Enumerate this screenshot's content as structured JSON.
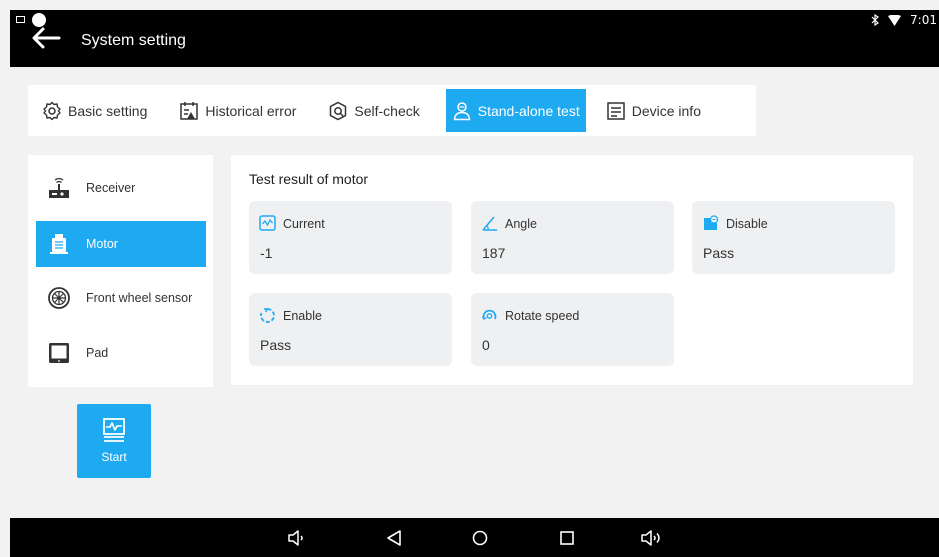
{
  "app": {
    "title": "System setting"
  },
  "status": {
    "time": "7:01",
    "bluetooth": "bluetooth-icon",
    "wifi": "wifi-icon"
  },
  "tabs": [
    {
      "label": "Basic setting",
      "icon": "gear-icon",
      "active": false
    },
    {
      "label": "Historical error",
      "icon": "error-log-icon",
      "active": false
    },
    {
      "label": "Self-check",
      "icon": "self-check-icon",
      "active": false
    },
    {
      "label": "Stand-alone test",
      "icon": "person-test-icon",
      "active": true
    },
    {
      "label": "Device info",
      "icon": "device-info-icon",
      "active": false
    }
  ],
  "sidebar": {
    "items": [
      {
        "label": "Receiver",
        "icon": "receiver-icon",
        "active": false
      },
      {
        "label": "Motor",
        "icon": "motor-icon",
        "active": true
      },
      {
        "label": "Front wheel sensor",
        "icon": "wheel-icon",
        "active": false
      },
      {
        "label": "Pad",
        "icon": "pad-icon",
        "active": false
      }
    ]
  },
  "start": {
    "label": "Start",
    "icon": "pulse-monitor-icon"
  },
  "result": {
    "title": "Test result of motor",
    "cards": [
      {
        "label": "Current",
        "value": "-1",
        "icon": "current-icon"
      },
      {
        "label": "Angle",
        "value": "187",
        "icon": "angle-icon"
      },
      {
        "label": "Disable",
        "value": "Pass",
        "icon": "disable-icon"
      },
      {
        "label": "Enable",
        "value": "Pass",
        "icon": "enable-icon"
      },
      {
        "label": "Rotate speed",
        "value": "0",
        "icon": "rotate-speed-icon"
      }
    ]
  },
  "colors": {
    "accent": "#1eaaf1",
    "card_bg": "#eff0f2",
    "page_bg": "#f2f2f2"
  }
}
